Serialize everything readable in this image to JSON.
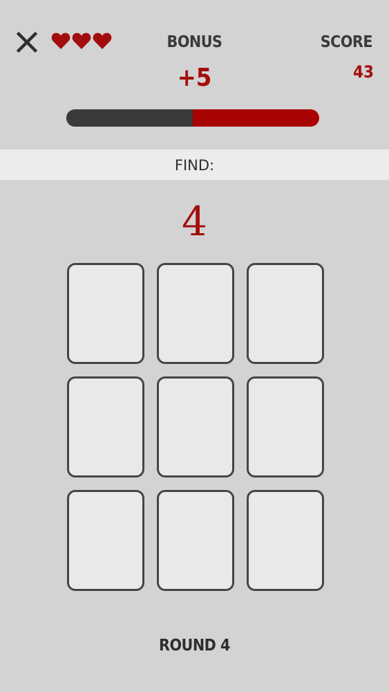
{
  "header": {
    "lives": 3,
    "bonus_label": "BONUS",
    "bonus_value": "+5",
    "score_label": "SCORE",
    "score_value": "43"
  },
  "bonus_timer": {
    "remaining_fraction": 0.5
  },
  "find": {
    "label": "FIND:",
    "target": "4"
  },
  "cards": [
    {
      "state": "face-down"
    },
    {
      "state": "face-down"
    },
    {
      "state": "face-down"
    },
    {
      "state": "face-down"
    },
    {
      "state": "face-down"
    },
    {
      "state": "face-down"
    },
    {
      "state": "face-down"
    },
    {
      "state": "face-down"
    },
    {
      "state": "face-down"
    }
  ],
  "footer": {
    "round_label": "ROUND 4"
  },
  "colors": {
    "accent_red": "#a30d0d",
    "bar_red": "#a80202",
    "dark": "#3a3a3a",
    "background": "#d3d3d3",
    "card_face": "#e9e8ea"
  },
  "icons": {
    "close": "close-icon",
    "life": "heart-icon"
  }
}
